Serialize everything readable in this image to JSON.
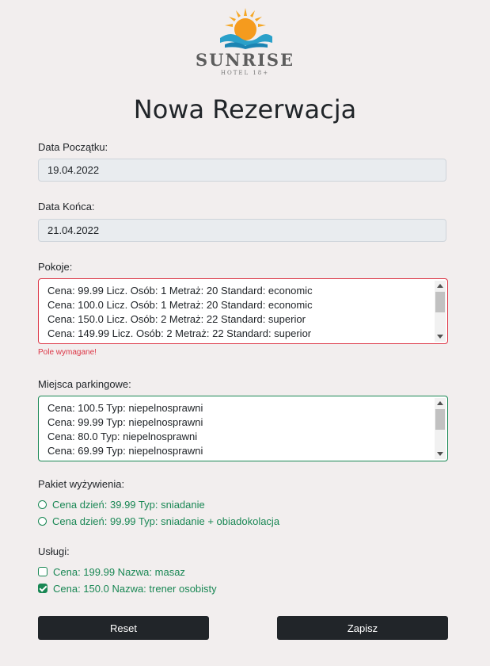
{
  "logo": {
    "name": "SUNRISE",
    "sub": "HOTEL 18+"
  },
  "title": "Nowa Rezerwacja",
  "start_date": {
    "label": "Data Początku:",
    "value": "19.04.2022"
  },
  "end_date": {
    "label": "Data Końca:",
    "value": "21.04.2022"
  },
  "rooms": {
    "label": "Pokoje:",
    "options": [
      "Cena: 99.99 Licz. Osób: 1 Metraż: 20 Standard: economic",
      "Cena: 100.0 Licz. Osób: 1 Metraż: 20 Standard: economic",
      "Cena: 150.0 Licz. Osób: 2 Metraż: 22 Standard: superior",
      "Cena: 149.99 Licz. Osób: 2 Metraż: 22 Standard: superior"
    ],
    "error": "Pole wymagane!"
  },
  "parking": {
    "label": "Miejsca parkingowe:",
    "options": [
      "Cena: 100.5 Typ: niepelnosprawni",
      "Cena: 99.99 Typ: niepelnosprawni",
      "Cena: 80.0 Typ: niepelnosprawni",
      "Cena: 69.99 Typ: niepelnosprawni"
    ]
  },
  "meal_plan": {
    "label": "Pakiet wyżywienia:",
    "options": [
      "Cena dzień: 39.99 Typ: sniadanie",
      "Cena dzień: 99.99 Typ: sniadanie + obiadokolacja"
    ]
  },
  "services": {
    "label": "Usługi:",
    "options": [
      {
        "text": "Cena: 199.99 Nazwa: masaz",
        "checked": false
      },
      {
        "text": "Cena: 150.0 Nazwa: trener osobisty",
        "checked": true
      }
    ]
  },
  "buttons": {
    "reset": "Reset",
    "save": "Zapisz"
  },
  "colors": {
    "accent": "#212529",
    "valid": "#198754",
    "invalid": "#dc3545",
    "sun": "#f5a623",
    "wave": "#2aa0c9"
  }
}
